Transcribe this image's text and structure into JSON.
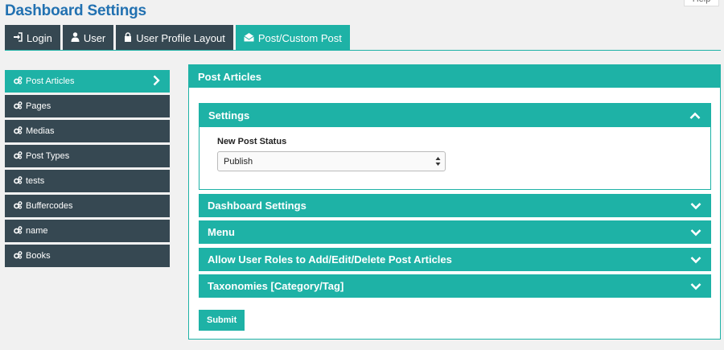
{
  "page": {
    "title": "Dashboard Settings",
    "help_label": "Help"
  },
  "tabs": [
    {
      "label": "Login",
      "icon": "sign-in-icon"
    },
    {
      "label": "User",
      "icon": "user-icon"
    },
    {
      "label": "User Profile Layout",
      "icon": "lock-icon"
    },
    {
      "label": "Post/Custom Post",
      "icon": "envelope-open-icon",
      "active": true
    }
  ],
  "sidebar": {
    "items": [
      {
        "label": "Post Articles",
        "active": true
      },
      {
        "label": "Pages"
      },
      {
        "label": "Medias"
      },
      {
        "label": "Post Types"
      },
      {
        "label": "tests"
      },
      {
        "label": "Buffercodes"
      },
      {
        "label": "name"
      },
      {
        "label": "Books"
      }
    ]
  },
  "panel": {
    "title": "Post Articles",
    "settings": {
      "title": "Settings",
      "field_label": "New Post Status",
      "select_value": "Publish"
    },
    "sections": [
      "Dashboard Settings",
      "Menu",
      "Allow User Roles to Add/Edit/Delete Post Articles",
      "Taxonomies [Category/Tag]"
    ],
    "submit_label": "Submit"
  },
  "colors": {
    "accent": "#1eb2a6",
    "dark": "#364852",
    "title": "#2271b1"
  }
}
